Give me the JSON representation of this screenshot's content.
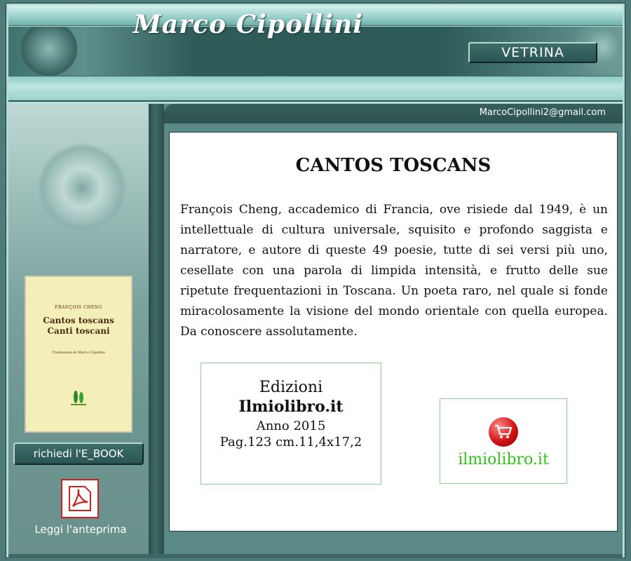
{
  "header": {
    "site_title": "Marco Cipollini",
    "vetrina_label": "VETRINA"
  },
  "contact": {
    "email": "MarcoCipollini2@gmail.com"
  },
  "book": {
    "title": "CANTOS TOSCANS",
    "description": "François Cheng, accademico di Francia, ove risiede dal 1949, è un intellettuale di cultura universale, squisito e profondo saggista e narratore, e autore di queste 49 poesie, tutte di sei versi più uno, cesellate con una parola di limpida intensità, e frutto delle sue ripetute frequentazioni in Toscana. Un poeta raro, nel quale si fonde miracolosamente la visione del mondo orientale con quella europea. Da conoscere assolutamente.",
    "cover": {
      "author": "FRANÇOIS CHENG",
      "title_line1": "Cantos toscans",
      "title_line2": "Canti toscani",
      "translation": "Traduzione di Marco Cipollini"
    }
  },
  "edition": {
    "line1": "Edizioni",
    "publisher": "Ilmiolibro.it",
    "year": "Anno 2015",
    "pages": "Pag.123 cm.11,4x17,2"
  },
  "shop": {
    "link_label": "ilmiolibro.it",
    "icon": "shopping-cart-icon"
  },
  "sidebar": {
    "ebook_button": "richiedi l'E_BOOK",
    "preview_label": "Leggi l'anteprima",
    "preview_icon": "pdf-icon"
  },
  "colors": {
    "frame_teal": "#4e7b78",
    "header_dark": "#2e5a57",
    "accent_green": "#33c21f",
    "cart_red": "#d11414"
  }
}
